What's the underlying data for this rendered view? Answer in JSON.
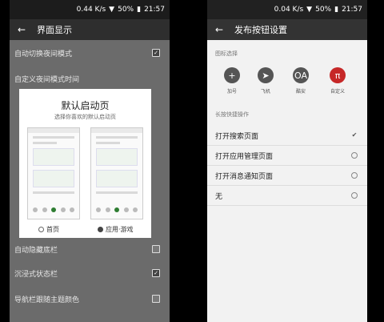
{
  "left": {
    "status": {
      "speed": "0.44 K/s",
      "battery": "50%",
      "time": "21:57"
    },
    "header": {
      "title": "界面显示"
    },
    "items": [
      {
        "label": "自动切换夜间模式"
      },
      {
        "label": "自定义夜间模式时间"
      },
      {
        "label": "自动隐藏底栏"
      },
      {
        "label": "沉浸式状态栏"
      },
      {
        "label": "导航栏跟随主题颜色"
      }
    ],
    "dialog": {
      "title": "默认启动页",
      "subtitle": "选择你喜欢的默认启动页",
      "options": [
        {
          "label": "首页",
          "selected": false
        },
        {
          "label": "应用·游戏",
          "selected": true
        }
      ]
    }
  },
  "right": {
    "status": {
      "speed": "0.04 K/s",
      "battery": "50%",
      "time": "21:57"
    },
    "header": {
      "title": "发布按钮设置"
    },
    "icon_section": "图标选择",
    "icons": [
      {
        "label": "加号",
        "icon": "plus-icon"
      },
      {
        "label": "飞机",
        "icon": "paper-plane-icon"
      },
      {
        "label": "酷安",
        "icon": "coolapk-icon"
      },
      {
        "label": "自定义",
        "icon": "pi-icon"
      }
    ],
    "long_press_section": "长按快捷操作",
    "options": [
      {
        "label": "打开搜索页面",
        "selected": true
      },
      {
        "label": "打开应用管理页面",
        "selected": false
      },
      {
        "label": "打开消息通知页面",
        "selected": false
      },
      {
        "label": "无",
        "selected": false
      }
    ]
  }
}
